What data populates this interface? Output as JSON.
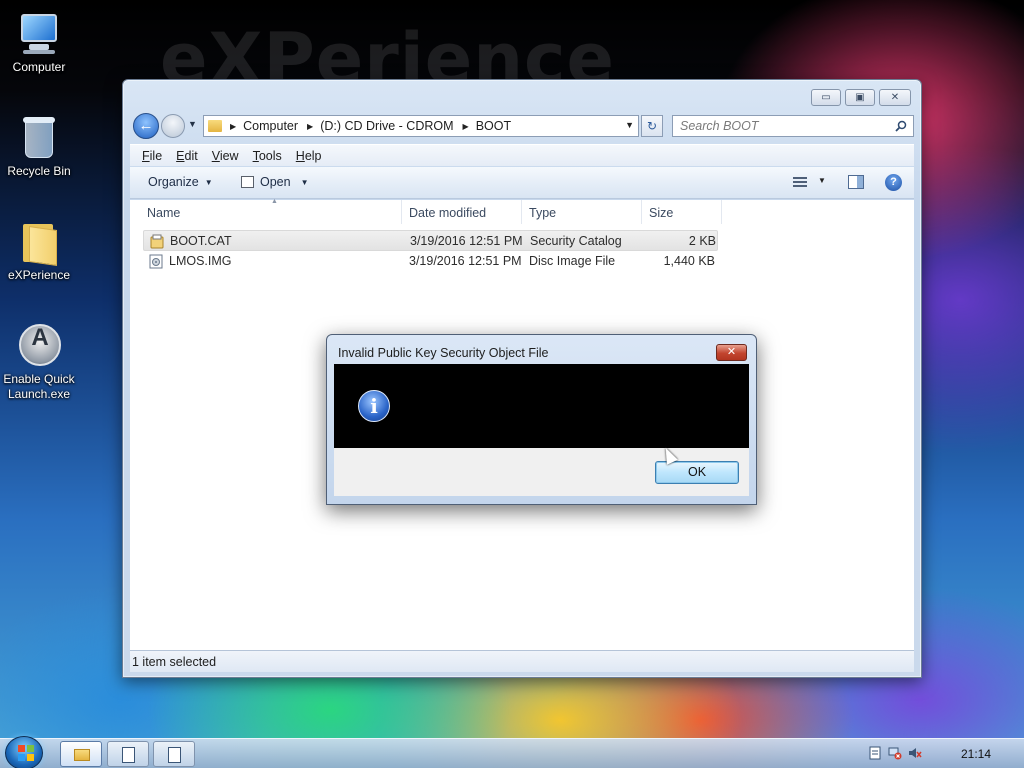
{
  "desktop": {
    "wordmark": "eXPerience",
    "icons": [
      {
        "label": "Computer",
        "icon": "computer-icon"
      },
      {
        "label": "Recycle Bin",
        "icon": "recycle-bin-icon"
      },
      {
        "label": "eXPerience",
        "icon": "folder-icon"
      },
      {
        "label_line1": "Enable Quick",
        "label_line2": "Launch.exe",
        "icon": "quick-launch-app-icon"
      }
    ]
  },
  "explorer": {
    "window_controls": {
      "minimize": "▭",
      "maximize": "▣",
      "close": "✕"
    },
    "breadcrumb": [
      "Computer",
      "(D:) CD Drive - CDROM",
      "BOOT"
    ],
    "search_placeholder": "Search BOOT",
    "menu": [
      "File",
      "Edit",
      "View",
      "Tools",
      "Help"
    ],
    "commands": {
      "organize": "Organize",
      "open": "Open"
    },
    "columns": [
      "Name",
      "Date modified",
      "Type",
      "Size"
    ],
    "files": [
      {
        "name": "BOOT.CAT",
        "date": "3/19/2016 12:51 PM",
        "type": "Security Catalog",
        "size": "2 KB",
        "selected": true,
        "icon": "security-catalog-icon"
      },
      {
        "name": "LMOS.IMG",
        "date": "3/19/2016 12:51 PM",
        "type": "Disc Image File",
        "size": "1,440 KB",
        "selected": false,
        "icon": "disc-image-icon"
      }
    ],
    "status": "1 item selected"
  },
  "dialog": {
    "title": "Invalid Public Key Security Object File",
    "close": "✕",
    "icon": "information-icon",
    "icon_glyph": "i",
    "ok_label": "OK"
  },
  "taskbar": {
    "clock": "21:14"
  },
  "colors": {
    "accent_blue": "#1f5fc0",
    "dialog_body": "#000000",
    "close_red": "#c2452f"
  }
}
